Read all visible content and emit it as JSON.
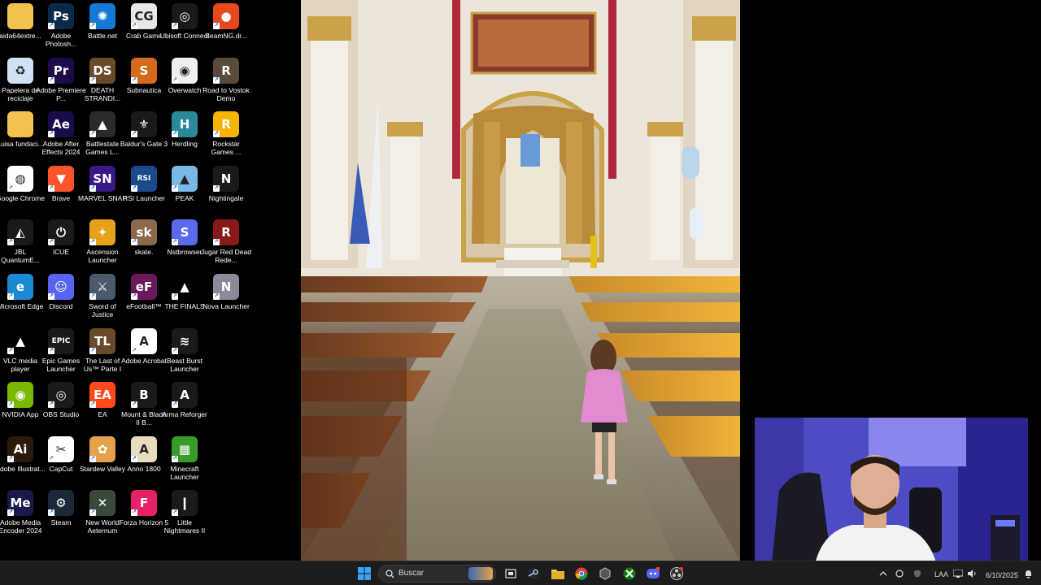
{
  "desktop": {
    "icons": [
      {
        "label": "aida64extre...",
        "icon": "folder-icon",
        "color": "#f2c14e",
        "glyph": ""
      },
      {
        "label": "Adobe Photosh...",
        "icon": "photoshop-icon",
        "color": "#0b2a4a",
        "glyph": "Ps"
      },
      {
        "label": "Battle.net",
        "icon": "battlenet-icon",
        "color": "#1478d4",
        "glyph": "✺"
      },
      {
        "label": "Crab Game",
        "icon": "crab-game-icon",
        "color": "#e8e8e8",
        "glyph": "CG"
      },
      {
        "label": "Ubisoft Connect",
        "icon": "ubisoft-icon",
        "color": "#1a1a1a",
        "glyph": "◎"
      },
      {
        "label": "BeamNG.dr...",
        "icon": "beamng-icon",
        "color": "#e8491c",
        "glyph": "●"
      },
      {
        "label": "Papelera de reciclaje",
        "icon": "recycle-bin-icon",
        "color": "#cfe3f4",
        "glyph": "♻"
      },
      {
        "label": "Adobe Premiere P...",
        "icon": "premiere-icon",
        "color": "#1d0b4a",
        "glyph": "Pr"
      },
      {
        "label": "DEATH STRANDI...",
        "icon": "death-stranding-icon",
        "color": "#6b4a2a",
        "glyph": "DS"
      },
      {
        "label": "Subnautica",
        "icon": "subnautica-icon",
        "color": "#d46a1a",
        "glyph": "S"
      },
      {
        "label": "Overwatch",
        "icon": "overwatch-icon",
        "color": "#f0f0f0",
        "glyph": "◉"
      },
      {
        "label": "Road to Vostok Demo",
        "icon": "road-to-vostok-icon",
        "color": "#5a4a3a",
        "glyph": "R"
      },
      {
        "label": "Luisa fundaci...",
        "icon": "folder-icon",
        "color": "#f2c14e",
        "glyph": ""
      },
      {
        "label": "Adobe After Effects 2024",
        "icon": "after-effects-icon",
        "color": "#1a0b4a",
        "glyph": "Ae"
      },
      {
        "label": "Battlestate Games L...",
        "icon": "battlestate-icon",
        "color": "#2a2a2a",
        "glyph": "▲"
      },
      {
        "label": "Baldur's Gate 3",
        "icon": "baldurs-gate-icon",
        "color": "#1a1a1a",
        "glyph": "⚜"
      },
      {
        "label": "Herdling",
        "icon": "herdling-icon",
        "color": "#2a8a9a",
        "glyph": "H"
      },
      {
        "label": "Rockstar Games ...",
        "icon": "rockstar-icon",
        "color": "#f5b400",
        "glyph": "R"
      },
      {
        "label": "Google Chrome",
        "icon": "chrome-icon",
        "color": "#ffffff",
        "glyph": "◍"
      },
      {
        "label": "Brave",
        "icon": "brave-icon",
        "color": "#fb542b",
        "glyph": "▼"
      },
      {
        "label": "MARVEL SNAP",
        "icon": "marvel-snap-icon",
        "color": "#3a1a8a",
        "glyph": "SN"
      },
      {
        "label": "RSI Launcher",
        "icon": "rsi-icon",
        "color": "#1a4a8a",
        "glyph": "RSI"
      },
      {
        "label": "PEAK",
        "icon": "peak-icon",
        "color": "#7ab8e6",
        "glyph": "▲"
      },
      {
        "label": "Nightingale",
        "icon": "nightingale-icon",
        "color": "#1a1a1a",
        "glyph": "N"
      },
      {
        "label": "JBL QuantumE...",
        "icon": "jbl-icon",
        "color": "#1a1a1a",
        "glyph": "◭"
      },
      {
        "label": "iCUE",
        "icon": "icue-icon",
        "color": "#1a1a1a",
        "glyph": "⏻"
      },
      {
        "label": "Ascension Launcher",
        "icon": "ascension-icon",
        "color": "#e6a21a",
        "glyph": "✦"
      },
      {
        "label": "skate.",
        "icon": "skate-icon",
        "color": "#8a6a4a",
        "glyph": "sk"
      },
      {
        "label": "Nstbrowser",
        "icon": "nstbrowser-icon",
        "color": "#5a6aea",
        "glyph": "S"
      },
      {
        "label": "Jugar Red Dead Rede...",
        "icon": "red-dead-icon",
        "color": "#8a1a1a",
        "glyph": "R"
      },
      {
        "label": "Microsoft Edge",
        "icon": "edge-icon",
        "color": "#1a8ad4",
        "glyph": "e"
      },
      {
        "label": "Discord",
        "icon": "discord-icon",
        "color": "#5865f2",
        "glyph": "☺"
      },
      {
        "label": "Sword of Justice",
        "icon": "sword-of-justice-icon",
        "color": "#4a5a6a",
        "glyph": "⚔"
      },
      {
        "label": "eFootball™",
        "icon": "efootball-icon",
        "color": "#6a1a5a",
        "glyph": "eF"
      },
      {
        "label": "THE FINALS",
        "icon": "the-finals-icon",
        "color": "#000000",
        "glyph": "▲"
      },
      {
        "label": "Nova Launcher",
        "icon": "nova-launcher-icon",
        "color": "#8a8a9a",
        "glyph": "N"
      },
      {
        "label": "VLC media player",
        "icon": "vlc-icon",
        "color": "#000000",
        "glyph": "▲"
      },
      {
        "label": "Epic Games Launcher",
        "icon": "epic-games-icon",
        "color": "#1a1a1a",
        "glyph": "EPIC"
      },
      {
        "label": "The Last of Us™ Parte I",
        "icon": "last-of-us-icon",
        "color": "#6a4a2a",
        "glyph": "TL"
      },
      {
        "label": "Adobe Acrobat",
        "icon": "acrobat-icon",
        "color": "#ffffff",
        "glyph": "A"
      },
      {
        "label": "Beast Burst Launcher",
        "icon": "beast-burst-icon",
        "color": "#1a1a1a",
        "glyph": "≋"
      },
      {
        "label": "NVIDIA App",
        "icon": "nvidia-icon",
        "color": "#76b900",
        "glyph": "◉"
      },
      {
        "label": "OBS Studio",
        "icon": "obs-icon",
        "color": "#1a1a1a",
        "glyph": "◎"
      },
      {
        "label": "EA",
        "icon": "ea-icon",
        "color": "#ff4a1a",
        "glyph": "EA"
      },
      {
        "label": "Mount & Blade II B...",
        "icon": "mount-blade-icon",
        "color": "#1a1a1a",
        "glyph": "B"
      },
      {
        "label": "Arma Reforger",
        "icon": "arma-icon",
        "color": "#1a1a1a",
        "glyph": "A"
      },
      {
        "label": "Adobe Illustrat...",
        "icon": "illustrator-icon",
        "color": "#2a1a0a",
        "glyph": "Ai"
      },
      {
        "label": "CapCut",
        "icon": "capcut-icon",
        "color": "#ffffff",
        "glyph": "✂"
      },
      {
        "label": "Stardew Valley",
        "icon": "stardew-icon",
        "color": "#e6a24a",
        "glyph": "✿"
      },
      {
        "label": "Anno 1800",
        "icon": "anno-icon",
        "color": "#e8dcc0",
        "glyph": "A"
      },
      {
        "label": "Minecraft Launcher",
        "icon": "minecraft-icon",
        "color": "#3a9a2a",
        "glyph": "▦"
      },
      {
        "label": "Adobe Media Encoder 2024",
        "icon": "media-encoder-icon",
        "color": "#1a1a4a",
        "glyph": "Me"
      },
      {
        "label": "Steam",
        "icon": "steam-icon",
        "color": "#1b2838",
        "glyph": "⚙"
      },
      {
        "label": "New World Aeternum",
        "icon": "new-world-icon",
        "color": "#3a4a3a",
        "glyph": "✕"
      },
      {
        "label": "Forza Horizon 5",
        "icon": "forza-icon",
        "color": "#e6206a",
        "glyph": "F"
      },
      {
        "label": "Little Nightmares II",
        "icon": "little-nightmares-icon",
        "color": "#1a1a1a",
        "glyph": "❙"
      }
    ]
  },
  "taskbar": {
    "search_placeholder": "Buscar",
    "tray_language": "LAA",
    "date": "6/10/2025"
  },
  "colors": {
    "taskbar_bg": "#1c1c1c",
    "desktop_bg": "#000000",
    "accent": "#0078d4"
  }
}
